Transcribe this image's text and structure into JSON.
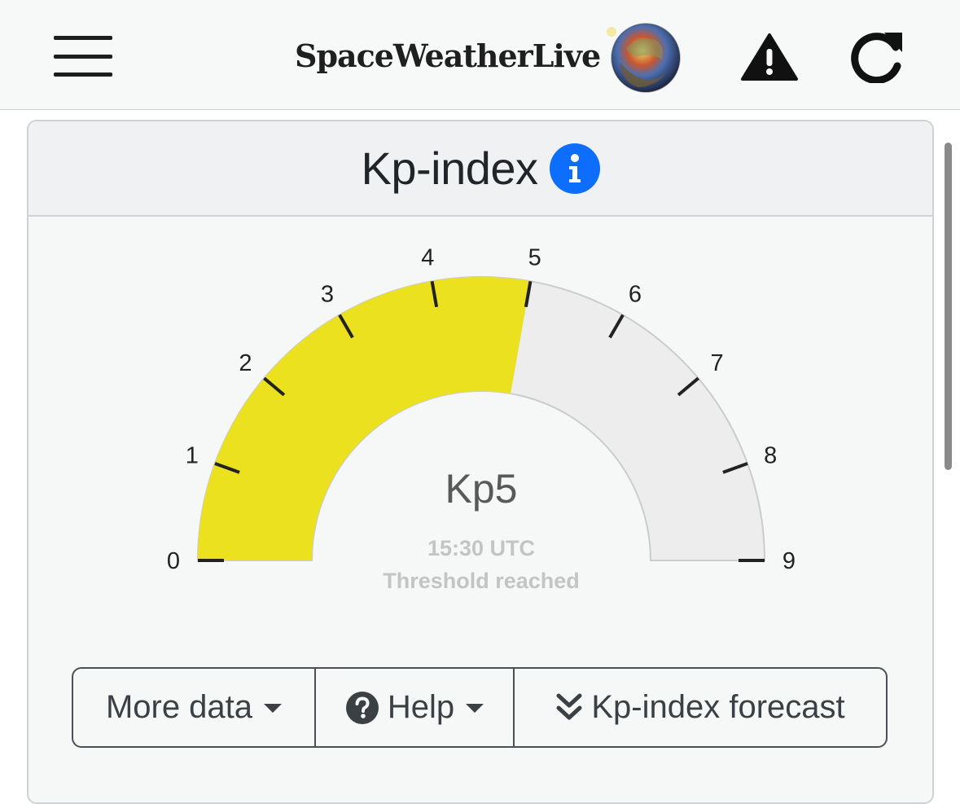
{
  "navbar": {
    "logo_text": "SpaceWeatherLive",
    "menu_icon": "hamburger-menu-icon",
    "alert_icon": "warning-triangle-icon",
    "refresh_icon": "refresh-icon"
  },
  "card": {
    "title": "Kp-index",
    "info_icon": "info-icon"
  },
  "gauge": {
    "min": 0,
    "max": 9,
    "value": 5,
    "value_label": "Kp5",
    "time": "15:30 UTC",
    "status": "Threshold reached",
    "ticks": [
      "0",
      "1",
      "2",
      "3",
      "4",
      "5",
      "6",
      "7",
      "8",
      "9"
    ],
    "colors": {
      "fill": "#ece11e",
      "track": "#ededed",
      "tick": "#222222"
    }
  },
  "buttons": {
    "more_data": "More data",
    "help": "Help",
    "forecast": "Kp-index forecast"
  }
}
